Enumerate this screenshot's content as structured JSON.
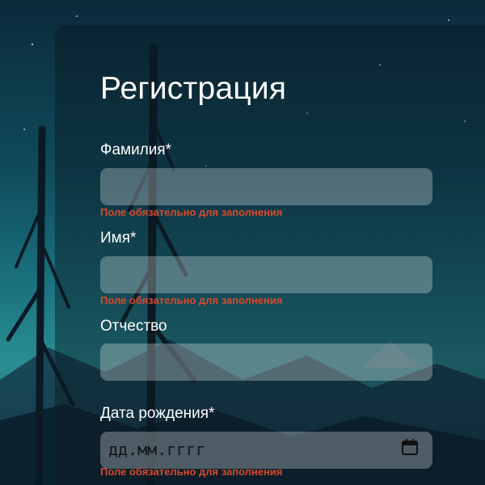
{
  "form": {
    "title": "Регистрация",
    "fields": [
      {
        "label": "Фамилия*",
        "value": "",
        "error": "Поле обязательно для заполнения"
      },
      {
        "label": "Имя*",
        "value": "",
        "error": "Поле обязательно для заполнения"
      },
      {
        "label": "Отчество",
        "value": ""
      },
      {
        "label": "Дата рождения*",
        "placeholder": "дд.мм.гггг",
        "error": "Поле обязательно для заполнения"
      }
    ]
  },
  "icons": {
    "date_picker": "calendar-icon"
  },
  "colors": {
    "error": "#d64a2f",
    "panel": "rgba(10,25,35,0.45)",
    "field": "rgba(255,255,255,0.28)"
  }
}
